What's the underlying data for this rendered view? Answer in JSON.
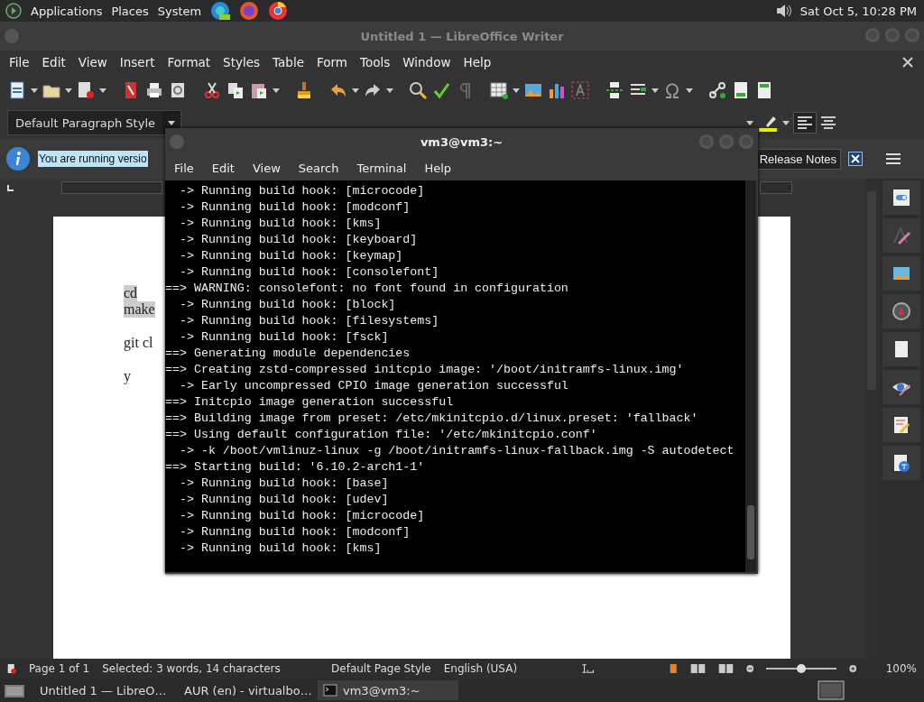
{
  "top_panel": {
    "menus": [
      "Applications",
      "Places",
      "System"
    ],
    "clock": "Sat Oct  5, 10:28 PM"
  },
  "writer": {
    "title": "Untitled 1 — LibreOffice Writer",
    "menu": [
      "File",
      "Edit",
      "View",
      "Insert",
      "Format",
      "Styles",
      "Table",
      "Form",
      "Tools",
      "Window",
      "Help"
    ],
    "paragraph_style": "Default Paragraph Style",
    "infobar": {
      "message": "You are running versio",
      "button": "Release Notes"
    },
    "document": {
      "lines": [
        {
          "text": "cd",
          "highlighted": true
        },
        {
          "text": "make",
          "highlighted": true
        },
        {
          "text": "git cl",
          "highlighted": false
        },
        {
          "text": "y",
          "highlighted": false
        }
      ]
    },
    "status_bar": {
      "page": "Page 1 of 1",
      "selection": "Selected: 3 words, 14 characters",
      "page_style": "Default Page Style",
      "language": "English (USA)",
      "zoom": {
        "level": 0.5,
        "reading": "100%"
      }
    }
  },
  "terminal": {
    "title": "vm3@vm3:~",
    "menu": [
      "File",
      "Edit",
      "View",
      "Search",
      "Terminal",
      "Help"
    ],
    "lines": [
      "  -> Running build hook: [microcode]",
      "  -> Running build hook: [modconf]",
      "  -> Running build hook: [kms]",
      "  -> Running build hook: [keyboard]",
      "  -> Running build hook: [keymap]",
      "  -> Running build hook: [consolefont]",
      "==> WARNING: consolefont: no font found in configuration",
      "  -> Running build hook: [block]",
      "  -> Running build hook: [filesystems]",
      "  -> Running build hook: [fsck]",
      "==> Generating module dependencies",
      "==> Creating zstd-compressed initcpio image: '/boot/initramfs-linux.img'",
      "  -> Early uncompressed CPIO image generation successful",
      "==> Initcpio image generation successful",
      "==> Building image from preset: /etc/mkinitcpio.d/linux.preset: 'fallback'",
      "==> Using default configuration file: '/etc/mkinitcpio.conf'",
      "  -> -k /boot/vmlinuz-linux -g /boot/initramfs-linux-fallback.img -S autodetect",
      "==> Starting build: '6.10.2-arch1-1'",
      "  -> Running build hook: [base]",
      "  -> Running build hook: [udev]",
      "  -> Running build hook: [microcode]",
      "  -> Running build hook: [modconf]",
      "  -> Running build hook: [kms]"
    ]
  },
  "taskbar": {
    "items": [
      {
        "label": "Untitled 1 — LibreO…",
        "selected": false
      },
      {
        "label": "AUR (en) - virtualbo…",
        "selected": false
      },
      {
        "label": "vm3@vm3:~",
        "selected": true
      }
    ]
  }
}
